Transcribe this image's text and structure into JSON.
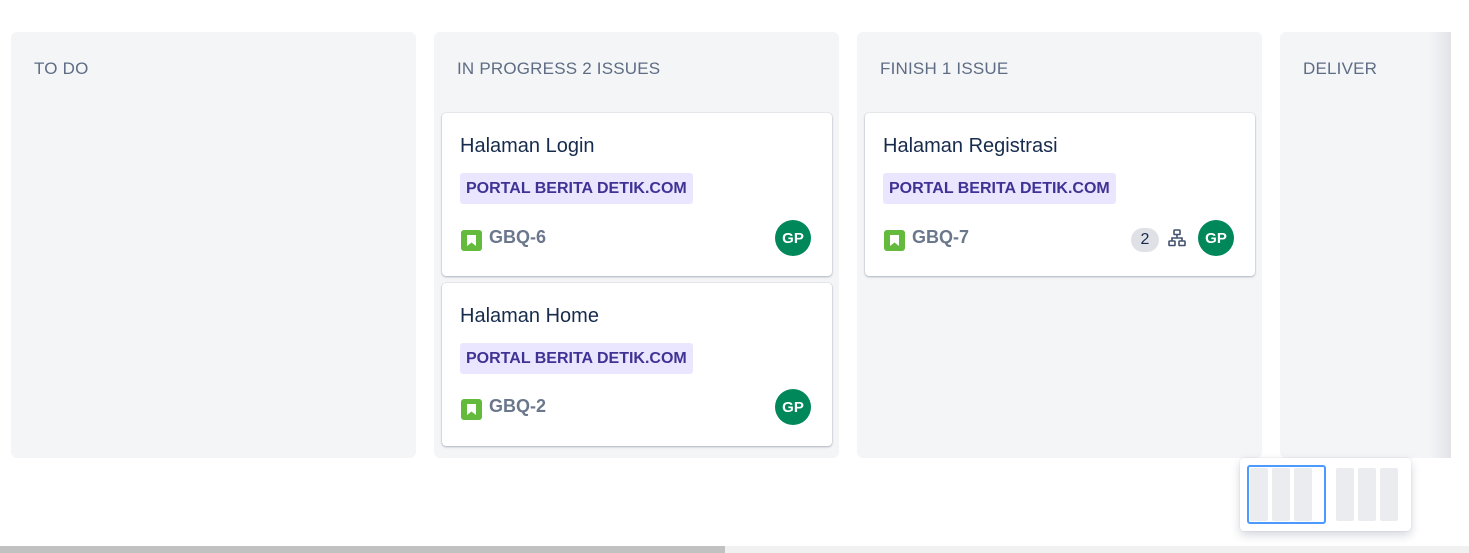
{
  "columns": [
    {
      "title": "TO DO",
      "cards": []
    },
    {
      "title": "IN PROGRESS 2 ISSUES",
      "cards": [
        {
          "title": "Halaman Login",
          "epic": "PORTAL BERITA DETIK.COM",
          "issue_type_icon": "story-bookmark-icon",
          "key": "GBQ-6",
          "assignee_initials": "GP"
        },
        {
          "title": "Halaman Home",
          "epic": "PORTAL BERITA DETIK.COM",
          "issue_type_icon": "story-bookmark-icon",
          "key": "GBQ-2",
          "assignee_initials": "GP"
        }
      ]
    },
    {
      "title": "FINISH 1 ISSUE",
      "cards": [
        {
          "title": "Halaman Registrasi",
          "epic": "PORTAL BERITA DETIK.COM",
          "issue_type_icon": "story-bookmark-icon",
          "key": "GBQ-7",
          "subtask_count": "2",
          "subtask_icon": "subtasks-icon",
          "assignee_initials": "GP"
        }
      ]
    },
    {
      "title": "DELIVER",
      "cards": []
    }
  ],
  "colors": {
    "column_bg": "#f4f5f7",
    "epic_bg": "#eae6ff",
    "epic_text": "#403294",
    "story_green": "#63ba3c",
    "avatar_green": "#00875a",
    "header_text": "#5e6c84",
    "minimap_viewport": "#4c9aff"
  }
}
